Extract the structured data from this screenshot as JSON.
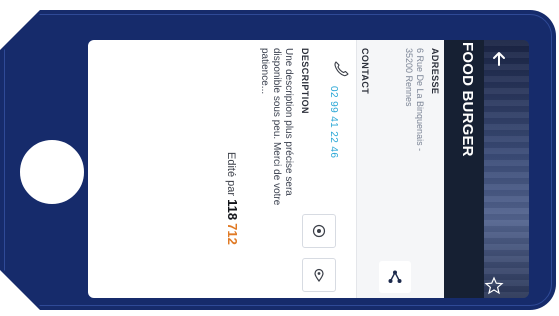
{
  "header": {
    "title": "FOOD BURGER"
  },
  "address": {
    "label": "ADRESSE",
    "value": "6 Rue De La Binquenais - 35200 Rennes"
  },
  "contact": {
    "label": "CONTACT",
    "phone": "02 99 41 22 46"
  },
  "description": {
    "label": "DESCRIPTION",
    "text": "Une description plus précise sera disponible sous peu. Merci de votre patience..."
  },
  "footer": {
    "prefix": "Edité par",
    "brand_part1": "118",
    "brand_part2": "712"
  },
  "colors": {
    "tag": "#162b6b",
    "header": "#1d2a4c",
    "phone": "#2aa7d6",
    "brand_accent": "#e07a25"
  },
  "icons": [
    "arrow-up-icon",
    "share-icon",
    "star-icon",
    "map-pin-icon",
    "directions-icon",
    "phone-icon"
  ]
}
